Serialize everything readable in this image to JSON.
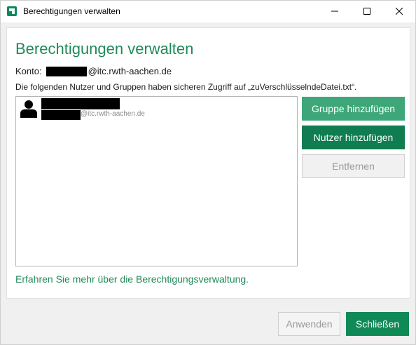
{
  "window": {
    "title": "Berechtigungen verwalten"
  },
  "panel": {
    "heading": "Berechtigungen verwalten",
    "konto_label": "Konto:",
    "konto_domain": "@itc.rwth-aachen.de",
    "info": "Die folgenden Nutzer und Gruppen haben sicheren Zugriff auf „zuVerschlüsselndeDatei.txt“.",
    "list": {
      "items": [
        {
          "email_domain": "@itc.rwth-aachen.de"
        }
      ]
    },
    "buttons": {
      "add_group": "Gruppe hinzufügen",
      "add_user": "Nutzer hinzufügen",
      "remove": "Entfernen"
    },
    "learn_more": "Erfahren Sie mehr über die Berechtigungsverwaltung."
  },
  "footer": {
    "apply": "Anwenden",
    "close": "Schließen"
  },
  "colors": {
    "accent": "#1f8a5a",
    "primary_button": "#0f7d50",
    "secondary_button": "#3ea779"
  }
}
